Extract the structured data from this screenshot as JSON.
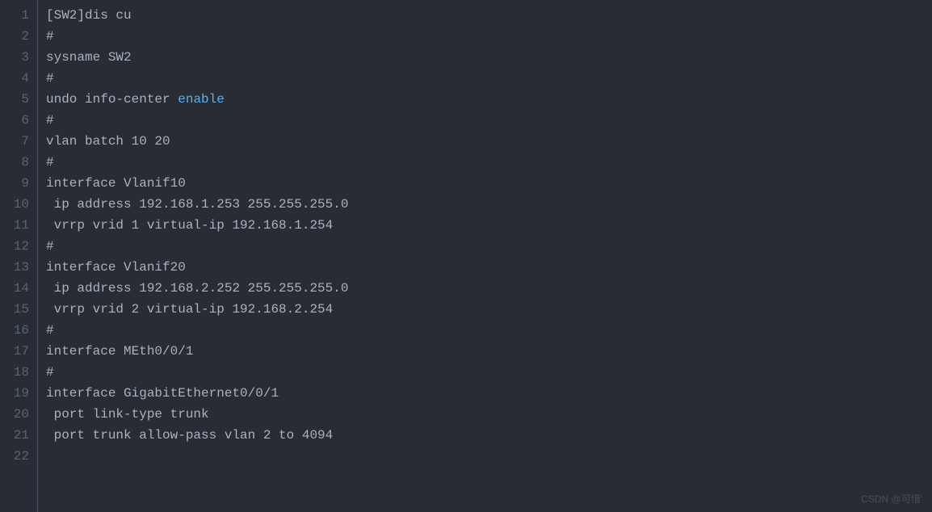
{
  "editor": {
    "lines": [
      {
        "n": 1,
        "segments": [
          {
            "t": "[SW2]dis cu",
            "c": ""
          }
        ]
      },
      {
        "n": 2,
        "segments": [
          {
            "t": "#",
            "c": ""
          }
        ]
      },
      {
        "n": 3,
        "segments": [
          {
            "t": "sysname SW2",
            "c": ""
          }
        ]
      },
      {
        "n": 4,
        "segments": [
          {
            "t": "#",
            "c": ""
          }
        ]
      },
      {
        "n": 5,
        "segments": [
          {
            "t": "undo info-center ",
            "c": ""
          },
          {
            "t": "enable",
            "c": "kw"
          }
        ]
      },
      {
        "n": 6,
        "segments": [
          {
            "t": "#",
            "c": ""
          }
        ]
      },
      {
        "n": 7,
        "segments": [
          {
            "t": "vlan batch 10 20",
            "c": ""
          }
        ]
      },
      {
        "n": 8,
        "segments": [
          {
            "t": "#",
            "c": ""
          }
        ]
      },
      {
        "n": 9,
        "segments": [
          {
            "t": "interface Vlanif10",
            "c": ""
          }
        ]
      },
      {
        "n": 10,
        "segments": [
          {
            "t": " ip address 192.168.1.253 255.255.255.0",
            "c": ""
          }
        ]
      },
      {
        "n": 11,
        "segments": [
          {
            "t": " vrrp vrid 1 virtual-ip 192.168.1.254",
            "c": ""
          }
        ]
      },
      {
        "n": 12,
        "segments": [
          {
            "t": "#",
            "c": ""
          }
        ]
      },
      {
        "n": 13,
        "segments": [
          {
            "t": "interface Vlanif20",
            "c": ""
          }
        ]
      },
      {
        "n": 14,
        "segments": [
          {
            "t": " ip address 192.168.2.252 255.255.255.0",
            "c": ""
          }
        ]
      },
      {
        "n": 15,
        "segments": [
          {
            "t": " vrrp vrid 2 virtual-ip 192.168.2.254",
            "c": ""
          }
        ]
      },
      {
        "n": 16,
        "segments": [
          {
            "t": "#",
            "c": ""
          }
        ]
      },
      {
        "n": 17,
        "segments": [
          {
            "t": "interface MEth0/0/1",
            "c": ""
          }
        ]
      },
      {
        "n": 18,
        "segments": [
          {
            "t": "#",
            "c": ""
          }
        ]
      },
      {
        "n": 19,
        "segments": [
          {
            "t": "interface GigabitEthernet0/0/1",
            "c": ""
          }
        ]
      },
      {
        "n": 20,
        "segments": [
          {
            "t": " port link-type trunk",
            "c": ""
          }
        ]
      },
      {
        "n": 21,
        "segments": [
          {
            "t": " port trunk allow-pass vlan 2 to 4094",
            "c": ""
          }
        ]
      },
      {
        "n": 22,
        "segments": [
          {
            "t": "",
            "c": ""
          }
        ]
      }
    ]
  },
  "watermark": "CSDN @可惜'"
}
